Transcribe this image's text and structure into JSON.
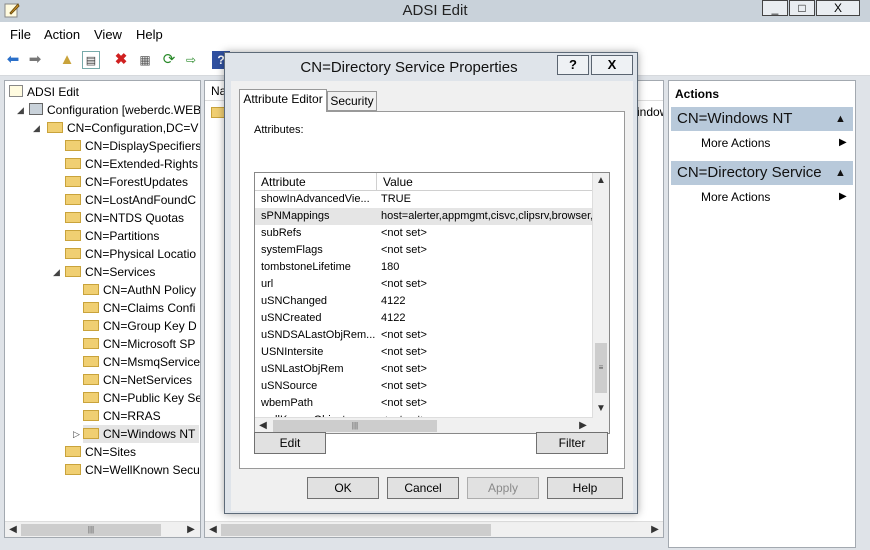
{
  "window": {
    "title": "ADSI Edit",
    "minimize": "_",
    "maximize": "□",
    "close": "X"
  },
  "menu": [
    "File",
    "Action",
    "View",
    "Help"
  ],
  "tree": {
    "root": "ADSI Edit",
    "connection": "Configuration [weberdc.WEB",
    "config": "CN=Configuration,DC=V",
    "children": [
      "CN=DisplaySpecifiers",
      "CN=Extended-Rights",
      "CN=ForestUpdates",
      "CN=LostAndFoundC",
      "CN=NTDS Quotas",
      "CN=Partitions",
      "CN=Physical Locatio"
    ],
    "services": "CN=Services",
    "service_children": [
      "CN=AuthN Policy",
      "CN=Claims Confi",
      "CN=Group Key D",
      "CN=Microsoft SP",
      "CN=MsmqService",
      "CN=NetServices",
      "CN=Public Key Se",
      "CN=RRAS",
      "CN=Windows NT"
    ],
    "after": [
      "CN=Sites",
      "CN=WellKnown Secu"
    ]
  },
  "list": {
    "column": "Na",
    "partial": "indow"
  },
  "actions": {
    "title": "Actions",
    "sections": [
      {
        "header": "CN=Windows NT",
        "item": "More Actions"
      },
      {
        "header": "CN=Directory Service",
        "item": "More Actions"
      }
    ]
  },
  "dialog": {
    "title": "CN=Directory Service Properties",
    "help_btn": "?",
    "close_btn": "X",
    "tabs": [
      "Attribute Editor",
      "Security"
    ],
    "attributes_label": "Attributes:",
    "col_attribute": "Attribute",
    "col_value": "Value",
    "rows": [
      {
        "name": "showInAdvancedVie...",
        "value": "TRUE"
      },
      {
        "name": "sPNMappings",
        "value": "host=alerter,appmgmt,cisvc,clipsrv,browser,d"
      },
      {
        "name": "subRefs",
        "value": "<not set>"
      },
      {
        "name": "systemFlags",
        "value": "<not set>"
      },
      {
        "name": "tombstoneLifetime",
        "value": "180"
      },
      {
        "name": "url",
        "value": "<not set>"
      },
      {
        "name": "uSNChanged",
        "value": "4122"
      },
      {
        "name": "uSNCreated",
        "value": "4122"
      },
      {
        "name": "uSNDSALastObjRem...",
        "value": "<not set>"
      },
      {
        "name": "USNIntersite",
        "value": "<not set>"
      },
      {
        "name": "uSNLastObjRem",
        "value": "<not set>"
      },
      {
        "name": "uSNSource",
        "value": "<not set>"
      },
      {
        "name": "wbemPath",
        "value": "<not set>"
      },
      {
        "name": "wellKnownObjects",
        "value": "<not set>"
      }
    ],
    "edit_btn": "Edit",
    "filter_btn": "Filter",
    "ok_btn": "OK",
    "cancel_btn": "Cancel",
    "apply_btn": "Apply",
    "help_footer_btn": "Help"
  },
  "colors": {
    "accent": "#b8c9da",
    "selection": "#cde8ff"
  }
}
